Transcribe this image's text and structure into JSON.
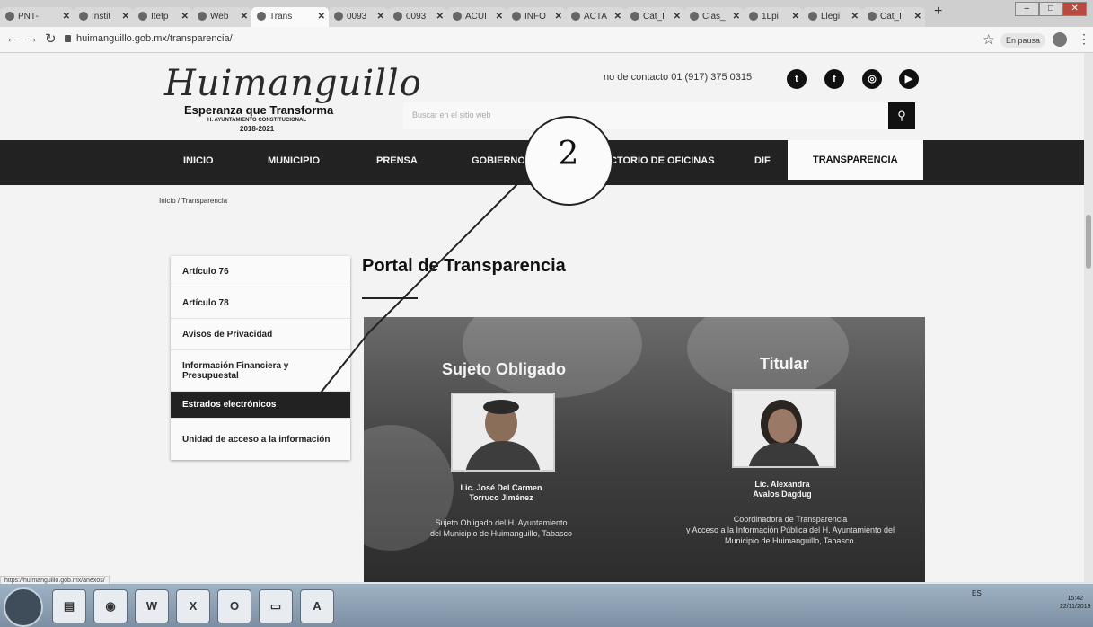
{
  "browser": {
    "tabs": [
      {
        "label": "PNT-"
      },
      {
        "label": "Instit"
      },
      {
        "label": "Itetp"
      },
      {
        "label": "Web"
      },
      {
        "label": "Trans"
      },
      {
        "label": "0093"
      },
      {
        "label": "0093"
      },
      {
        "label": "ACUI"
      },
      {
        "label": "INFO"
      },
      {
        "label": "ACTA"
      },
      {
        "label": "Cat_I"
      },
      {
        "label": "Clas_"
      },
      {
        "label": "1Lpi"
      },
      {
        "label": "Llegi"
      },
      {
        "label": "Cat_I"
      }
    ],
    "tab_close": "✕",
    "new_tab": "+",
    "url": "huimanguillo.gob.mx/transparencia/",
    "pause_label": "En pausa",
    "status_url": "https://huimanguillo.gob.mx/anexos/"
  },
  "site": {
    "logo_script": "Huimanguillo",
    "slogan": "Esperanza que Transforma",
    "ayuntamiento": "H. AYUNTAMIENTO CONSTITUCIONAL",
    "period": "2018-2021",
    "contact": "no de contacto 01 (917) 375 0315",
    "search_placeholder": "Buscar en el sitio web",
    "nav": [
      "INICIO",
      "MUNICIPIO",
      "PRENSA",
      "GOBIERNO",
      "CTORIO DE OFICINAS",
      "DIF",
      "TRANSPARENCIA"
    ],
    "breadcrumb": "Inicio / Transparencia",
    "page_title": "Portal de Transparencia",
    "side_menu": [
      "Artículo 76",
      "Artículo 78",
      "Avisos de Privacidad",
      "Información Financiera y Presupuestal",
      "Estrados electrónicos",
      "Unidad de acceso a la información"
    ],
    "banner": {
      "left_heading": "Sujeto Obligado",
      "left_name_1": "Lic. José Del Carmen",
      "left_name_2": "Torruco Jiménez",
      "left_role_1": "Sujeto Obligado del H. Ayuntamiento",
      "left_role_2": "del Municipio de Huimanguillo, Tabasco",
      "right_heading": "Titular",
      "right_name_1": "Lic. Alexandra",
      "right_name_2": "Avalos Dagdug",
      "right_role_1": "Coordinadora de Transparencia",
      "right_role_2": "y Acceso a la Información Pública del H. Ayuntamiento del",
      "right_role_3": "Municipio de Huimanguillo, Tabasco."
    }
  },
  "annotation": {
    "number": "2"
  },
  "taskbar": {
    "tray": "ES",
    "time": "15:42",
    "date": "22/11/2019"
  },
  "colors": {
    "nav_bg": "#222222",
    "menu_active": "#222222",
    "banner": "#3f3f3f"
  }
}
